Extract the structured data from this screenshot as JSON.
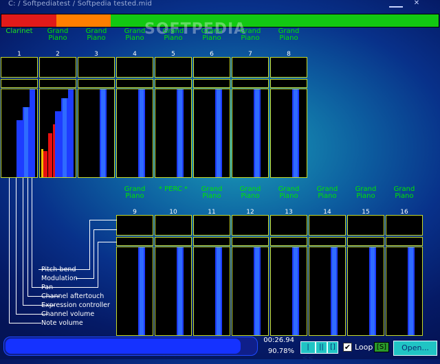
{
  "window": {
    "title": "C: / Softpediatest / Softpedia tested.mid",
    "watermark": "SOFTPEDIA"
  },
  "status_strip": [
    {
      "color": "#e01a1a",
      "fraction": 0.125
    },
    {
      "color": "#ff7e00",
      "fraction": 0.125
    },
    {
      "color": "#12c812",
      "fraction": 0.75
    }
  ],
  "channels": [
    {
      "num": "1",
      "instrument": "Clarinet",
      "levels": {
        "note": 0,
        "vol": 0.65,
        "expr": 0.8,
        "after": 1.0
      },
      "red": []
    },
    {
      "num": "2",
      "instrument": "Grand\nPiano",
      "levels": {
        "note": 0,
        "vol": 0.75,
        "expr": 0.9,
        "after": 1.0
      },
      "red": [
        0.3,
        0.5,
        0.6
      ]
    },
    {
      "num": "3",
      "instrument": "Grand\nPiano",
      "levels": {
        "note": 0,
        "vol": 0,
        "expr": 1.0,
        "after": 0
      },
      "red": []
    },
    {
      "num": "4",
      "instrument": "Grand\nPiano",
      "levels": {
        "note": 0,
        "vol": 0,
        "expr": 1.0,
        "after": 0
      },
      "red": []
    },
    {
      "num": "5",
      "instrument": "Grand\nPiano",
      "levels": {
        "note": 0,
        "vol": 0,
        "expr": 1.0,
        "after": 0
      },
      "red": []
    },
    {
      "num": "6",
      "instrument": "Grand\nPiano",
      "levels": {
        "note": 0,
        "vol": 0,
        "expr": 1.0,
        "after": 0
      },
      "red": []
    },
    {
      "num": "7",
      "instrument": "Grand\nPiano",
      "levels": {
        "note": 0,
        "vol": 0,
        "expr": 1.0,
        "after": 0
      },
      "red": []
    },
    {
      "num": "8",
      "instrument": "Grand\nPiano",
      "levels": {
        "note": 0,
        "vol": 0,
        "expr": 1.0,
        "after": 0
      },
      "red": []
    },
    {
      "num": "9",
      "instrument": "Grand\nPiano",
      "levels": {
        "note": 0,
        "vol": 0,
        "expr": 1.0,
        "after": 0
      },
      "red": []
    },
    {
      "num": "10",
      "instrument": "* PERC *",
      "levels": {
        "note": 0,
        "vol": 0,
        "expr": 1.0,
        "after": 0
      },
      "red": []
    },
    {
      "num": "11",
      "instrument": "Grand\nPiano",
      "levels": {
        "note": 0,
        "vol": 0,
        "expr": 1.0,
        "after": 0
      },
      "red": []
    },
    {
      "num": "12",
      "instrument": "Grand\nPiano",
      "levels": {
        "note": 0,
        "vol": 0,
        "expr": 1.0,
        "after": 0
      },
      "red": []
    },
    {
      "num": "13",
      "instrument": "Grand\nPiano",
      "levels": {
        "note": 0,
        "vol": 0,
        "expr": 1.0,
        "after": 0
      },
      "red": []
    },
    {
      "num": "14",
      "instrument": "Grand\nPiano",
      "levels": {
        "note": 0,
        "vol": 0,
        "expr": 1.0,
        "after": 0
      },
      "red": []
    },
    {
      "num": "15",
      "instrument": "Grand\nPiano",
      "levels": {
        "note": 0,
        "vol": 0,
        "expr": 1.0,
        "after": 0
      },
      "red": []
    },
    {
      "num": "16",
      "instrument": "Grand\nPiano",
      "levels": {
        "note": 0,
        "vol": 0,
        "expr": 1.0,
        "after": 0
      },
      "red": []
    }
  ],
  "legend": {
    "pitch_bend": "Pitch-bend",
    "modulation": "Modulation",
    "pan": "Pan",
    "channel_aftertouch": "Channel aftertouch",
    "expression_controller": "Expression controller",
    "channel_volume": "Channel volume",
    "note_volume": "Note volume"
  },
  "transport": {
    "progress": 0.93,
    "time": "00:26.94",
    "percent": "90.78%",
    "rewind_label": "|<<",
    "pause_label": "||",
    "stop_label": "[]",
    "loop_checked": true,
    "loop_label": "Loop",
    "s_label": "[S]",
    "open_label": "Open..."
  },
  "colors": {
    "background": "#08318a",
    "instrument_text": "#00e600",
    "meter_blue": "#1e3cff",
    "meter_bright": "#2f6bff",
    "meter_red": "#e81010",
    "meter_yellow": "#f0c000",
    "box_border": "#c8dc2a",
    "button": "#20c4c4"
  }
}
